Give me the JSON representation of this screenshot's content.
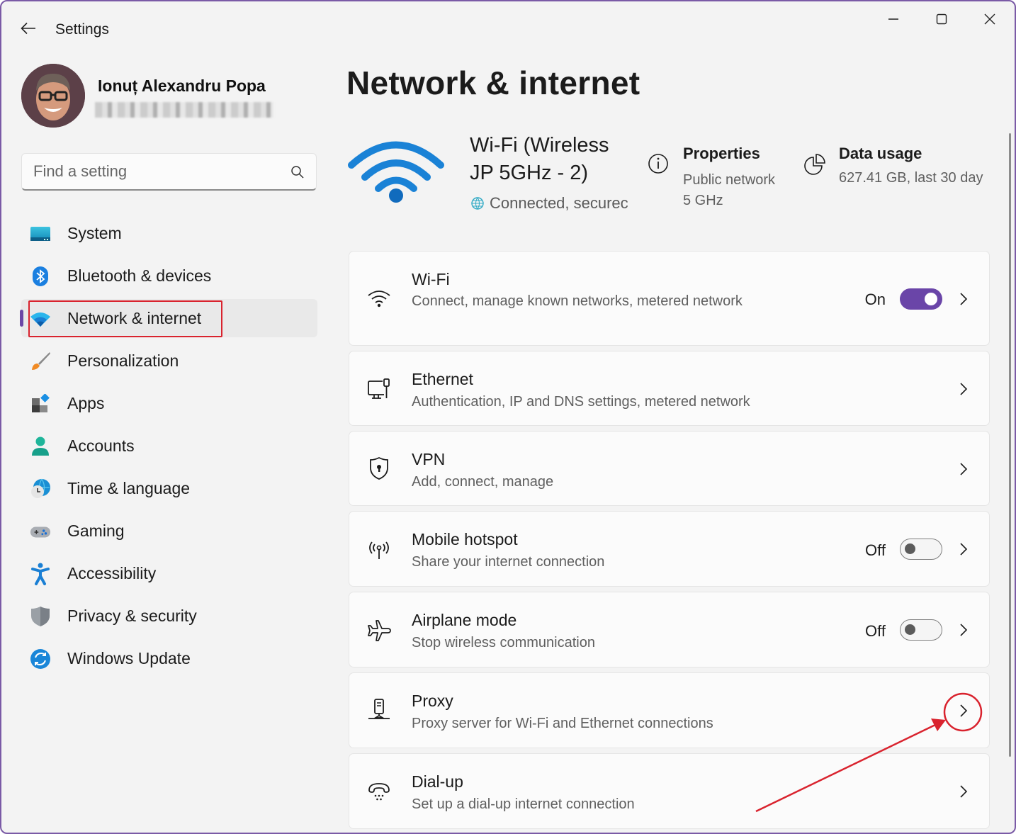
{
  "window": {
    "app_title": "Settings",
    "controls": {
      "minimize": "minimize",
      "maximize": "maximize",
      "close": "close"
    }
  },
  "profile": {
    "name": "Ionuț Alexandru Popa",
    "email_redacted": true
  },
  "search": {
    "placeholder": "Find a setting",
    "value": ""
  },
  "sidebar": {
    "items": [
      {
        "label": "System",
        "icon": "system-icon",
        "active": false
      },
      {
        "label": "Bluetooth & devices",
        "icon": "bluetooth-icon",
        "active": false
      },
      {
        "label": "Network & internet",
        "icon": "wifi-icon",
        "active": true,
        "highlighted": true
      },
      {
        "label": "Personalization",
        "icon": "paintbrush-icon",
        "active": false
      },
      {
        "label": "Apps",
        "icon": "apps-icon",
        "active": false
      },
      {
        "label": "Accounts",
        "icon": "account-icon",
        "active": false
      },
      {
        "label": "Time & language",
        "icon": "clock-globe-icon",
        "active": false
      },
      {
        "label": "Gaming",
        "icon": "gamepad-icon",
        "active": false
      },
      {
        "label": "Accessibility",
        "icon": "accessibility-icon",
        "active": false
      },
      {
        "label": "Privacy & security",
        "icon": "shield-icon",
        "active": false
      },
      {
        "label": "Windows Update",
        "icon": "update-icon",
        "active": false
      }
    ]
  },
  "main": {
    "title": "Network & internet",
    "hero": {
      "network_name": "Wi-Fi (Wireless JP 5GHz - 2)",
      "status": "Connected, securec",
      "properties": {
        "title": "Properties",
        "line1": "Public network",
        "line2": "5 GHz"
      },
      "data_usage": {
        "title": "Data usage",
        "value": "627.41 GB, last 30 day"
      }
    },
    "cards": [
      {
        "title": "Wi-Fi",
        "subtitle": "Connect, manage known networks, metered network",
        "icon": "wifi-icon",
        "state_label": "On",
        "toggle": true
      },
      {
        "title": "Ethernet",
        "subtitle": "Authentication, IP and DNS settings, metered network",
        "icon": "ethernet-icon"
      },
      {
        "title": "VPN",
        "subtitle": "Add, connect, manage",
        "icon": "vpn-shield-icon"
      },
      {
        "title": "Mobile hotspot",
        "subtitle": "Share your internet connection",
        "icon": "hotspot-icon",
        "state_label": "Off",
        "toggle": false
      },
      {
        "title": "Airplane mode",
        "subtitle": "Stop wireless communication",
        "icon": "airplane-icon",
        "state_label": "Off",
        "toggle": false
      },
      {
        "title": "Proxy",
        "subtitle": "Proxy server for Wi-Fi and Ethernet connections",
        "icon": "proxy-icon",
        "annotated": true
      },
      {
        "title": "Dial-up",
        "subtitle": "Set up a dial-up internet connection",
        "icon": "dialup-icon"
      }
    ]
  },
  "colors": {
    "accent": "#6a45a8",
    "annotation_red": "#d9232e",
    "wifi_blue": "#1a7fd4",
    "window_border": "#7a5aa6"
  }
}
